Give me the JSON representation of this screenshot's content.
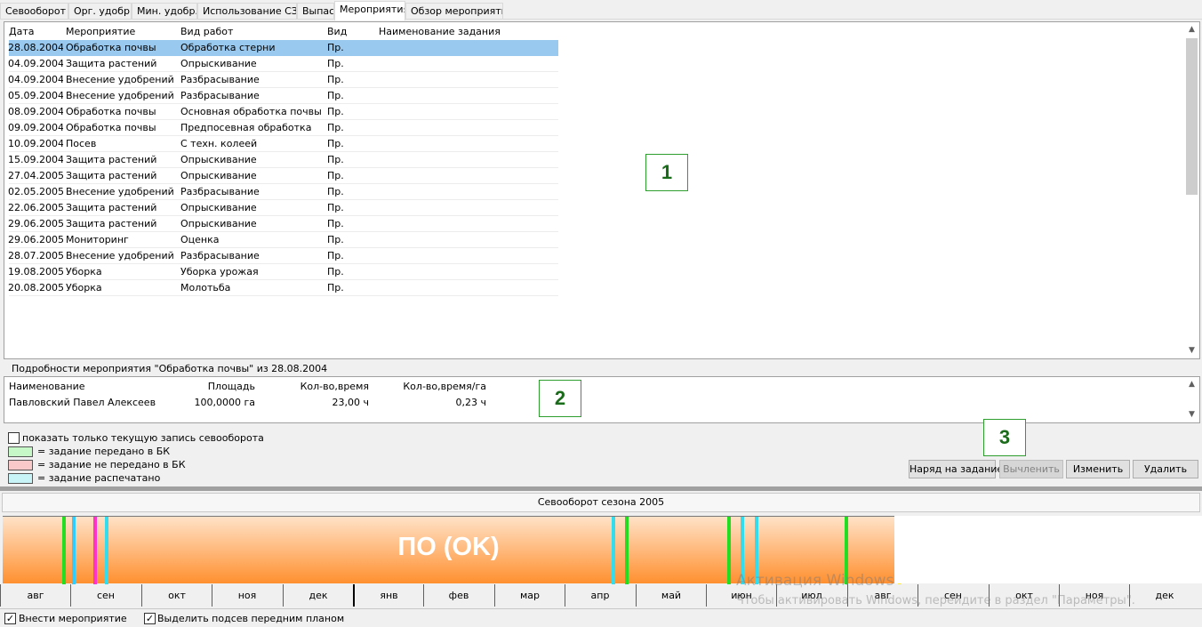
{
  "tabs": [
    {
      "label": "Севооборот",
      "active": false
    },
    {
      "label": "Орг. удобр.",
      "active": false
    },
    {
      "label": "Мин. удобр.",
      "active": false
    },
    {
      "label": "Использование СЗР",
      "active": false
    },
    {
      "label": "Выпас",
      "active": false
    },
    {
      "label": "Мероприятия",
      "active": true
    },
    {
      "label": "Обзор мероприятий",
      "active": false
    }
  ],
  "events_table": {
    "columns": [
      "Дата",
      "Мероприятие",
      "Вид работ",
      "Вид",
      "Наименование задания"
    ],
    "rows": [
      [
        "28.08.2004",
        "Обработка почвы",
        "Обработка стерни",
        "Пр.",
        ""
      ],
      [
        "04.09.2004",
        "Защита растений",
        "Опрыскивание",
        "Пр.",
        ""
      ],
      [
        "04.09.2004",
        "Внесение удобрений",
        "Разбрасывание",
        "Пр.",
        ""
      ],
      [
        "05.09.2004",
        "Внесение удобрений",
        "Разбрасывание",
        "Пр.",
        ""
      ],
      [
        "08.09.2004",
        "Обработка почвы",
        "Основная обработка почвы",
        "Пр.",
        ""
      ],
      [
        "09.09.2004",
        "Обработка почвы",
        "Предпосевная обработка",
        "Пр.",
        ""
      ],
      [
        "10.09.2004",
        "Посев",
        "С техн. колеей",
        "Пр.",
        ""
      ],
      [
        "15.09.2004",
        "Защита растений",
        "Опрыскивание",
        "Пр.",
        ""
      ],
      [
        "27.04.2005",
        "Защита растений",
        "Опрыскивание",
        "Пр.",
        ""
      ],
      [
        "02.05.2005",
        "Внесение удобрений",
        "Разбрасывание",
        "Пр.",
        ""
      ],
      [
        "22.06.2005",
        "Защита растений",
        "Опрыскивание",
        "Пр.",
        ""
      ],
      [
        "29.06.2005",
        "Защита растений",
        "Опрыскивание",
        "Пр.",
        ""
      ],
      [
        "29.06.2005",
        "Мониторинг",
        "Оценка",
        "Пр.",
        ""
      ],
      [
        "28.07.2005",
        "Внесение удобрений",
        "Разбрасывание",
        "Пр.",
        ""
      ],
      [
        "19.08.2005",
        "Уборка",
        "Уборка урожая",
        "Пр.",
        ""
      ],
      [
        "20.08.2005",
        "Уборка",
        "Молотьба",
        "Пр.",
        ""
      ]
    ],
    "selected_row": 0
  },
  "markers": {
    "m1": "1",
    "m2": "2",
    "m3": "3"
  },
  "details": {
    "title": "Подробности мероприятия \"Обработка почвы\" из 28.08.2004",
    "columns": [
      "Наименование",
      "Площадь",
      "Кол-во,время",
      "Кол-во,время/га"
    ],
    "rows": [
      [
        "Павловский Павел Алексеевич",
        "100,0000 га",
        "23,00 ч",
        "0,23 ч"
      ]
    ]
  },
  "options": {
    "show_current_only": {
      "label": "показать только текущую запись севооборота",
      "checked": false
    }
  },
  "legend": [
    {
      "label": "= задание передано в БК",
      "color": "#c6f7c6"
    },
    {
      "label": "= задание не передано в БК",
      "color": "#f9c8c8"
    },
    {
      "label": "= задание распечатано",
      "color": "#c8f4f8"
    }
  ],
  "buttons": {
    "order": "Наряд на задание",
    "calc": "Вычленить",
    "edit": "Изменить",
    "delete": "Удалить"
  },
  "season": {
    "title": "Севооборот сезона 2005",
    "timeline_label": "ПО (OK)",
    "lines": [
      {
        "month_pos": 0.84,
        "color": "#22dd22"
      },
      {
        "month_pos": 0.98,
        "color": "#33ccff"
      },
      {
        "month_pos": 1.28,
        "color": "#ff33cc"
      },
      {
        "month_pos": 1.45,
        "color": "#33ddee"
      },
      {
        "month_pos": 8.63,
        "color": "#33ddee"
      },
      {
        "month_pos": 8.82,
        "color": "#22dd22"
      },
      {
        "month_pos": 10.27,
        "color": "#22dd22"
      },
      {
        "month_pos": 10.45,
        "color": "#33ddee"
      },
      {
        "month_pos": 10.66,
        "color": "#33ddee"
      },
      {
        "month_pos": 11.93,
        "color": "#22dd22"
      },
      {
        "month_pos": 12.68,
        "color": "#ffee33"
      }
    ],
    "months": [
      "авг",
      "сен",
      "окт",
      "ноя",
      "дек",
      "янв",
      "фев",
      "мар",
      "апр",
      "май",
      "июн",
      "июл",
      "авг",
      "сен",
      "окт",
      "ноя",
      "дек"
    ]
  },
  "bottom": {
    "enter_events": {
      "label": "Внести мероприятие",
      "checked": true
    },
    "highlight": {
      "label": "Выделить подсев передним планом",
      "checked": true
    }
  },
  "watermark": {
    "line1": "Активация Windows",
    "line2": "Чтобы активировать Windows, перейдите в раздел \"Параметры\"."
  }
}
